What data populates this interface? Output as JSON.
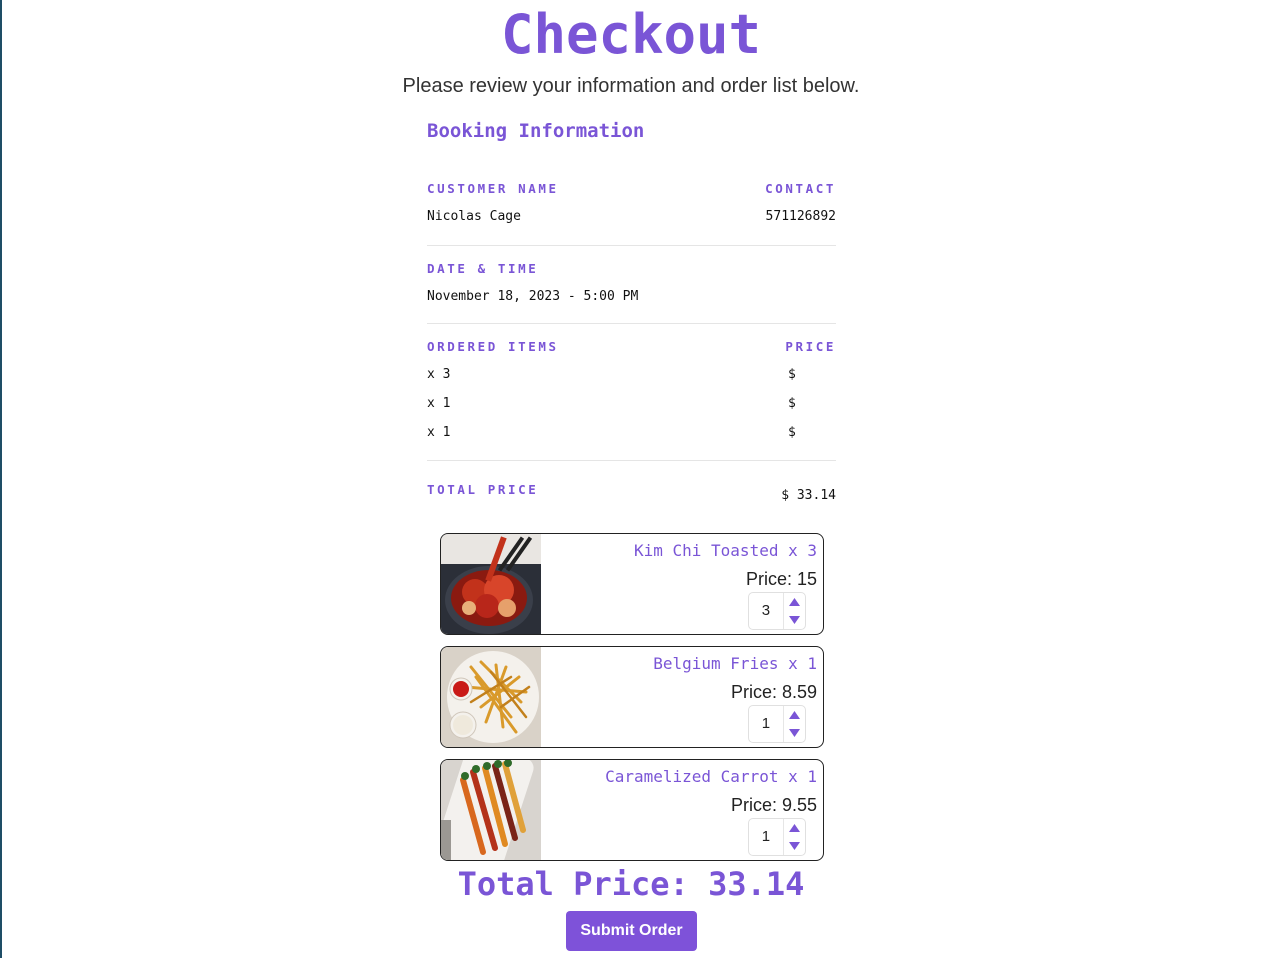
{
  "page": {
    "title": "Checkout",
    "subtitle": "Please review your information and order list below."
  },
  "booking": {
    "heading": "Booking Information",
    "customer_name_label": "CUSTOMER NAME",
    "customer_name": "Nicolas Cage",
    "contact_label": "CONTACT",
    "contact": "571126892",
    "datetime_label": "DATE & TIME",
    "datetime": "November 18, 2023 - 5:00 PM",
    "items_label": "ORDERED ITEMS",
    "price_label": "PRICE",
    "items": [
      {
        "qty": "x 3",
        "price": "$"
      },
      {
        "qty": "x 1",
        "price": "$"
      },
      {
        "qty": "x 1",
        "price": "$"
      }
    ],
    "total_label": "TOTAL PRICE",
    "total": "$ 33.14"
  },
  "cart": [
    {
      "name": "Kim Chi Toasted x 3",
      "price": "Price: 15",
      "quantity": "3",
      "photo_icon": "kimchi-photo"
    },
    {
      "name": "Belgium Fries x 1",
      "price": "Price: 8.59",
      "quantity": "1",
      "photo_icon": "fries-photo"
    },
    {
      "name": "Caramelized Carrot x 1",
      "price": "Price: 9.55",
      "quantity": "1",
      "photo_icon": "carrot-photo"
    }
  ],
  "grand_total": "Total Price: 33.14",
  "submit_label": "Submit Order",
  "colors": {
    "accent": "#7a55d6",
    "button": "#7e52d9",
    "text": "#222222",
    "divider": "#e5e5e5"
  }
}
